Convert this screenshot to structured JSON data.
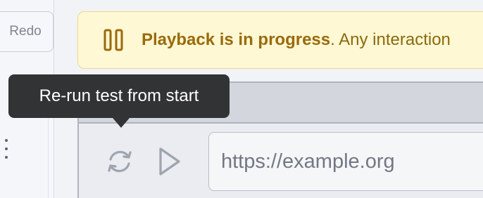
{
  "toolbar": {
    "redo_label": "Redo"
  },
  "banner": {
    "title": "Playback is in progress",
    "message": ". Any interaction",
    "icon": "pause-icon"
  },
  "tooltip": {
    "text": "Re-run test from start"
  },
  "browser": {
    "reload_icon": "reload-icon",
    "play_icon": "play-icon",
    "url": "https://example.org"
  },
  "sidebar": {
    "menu_icon": "kebab-menu-icon"
  },
  "colors": {
    "banner_bg": "#fff8d4",
    "banner_text": "#9a6a0c",
    "tooltip_bg": "#323335",
    "icon_gray": "#9ea4b0"
  }
}
